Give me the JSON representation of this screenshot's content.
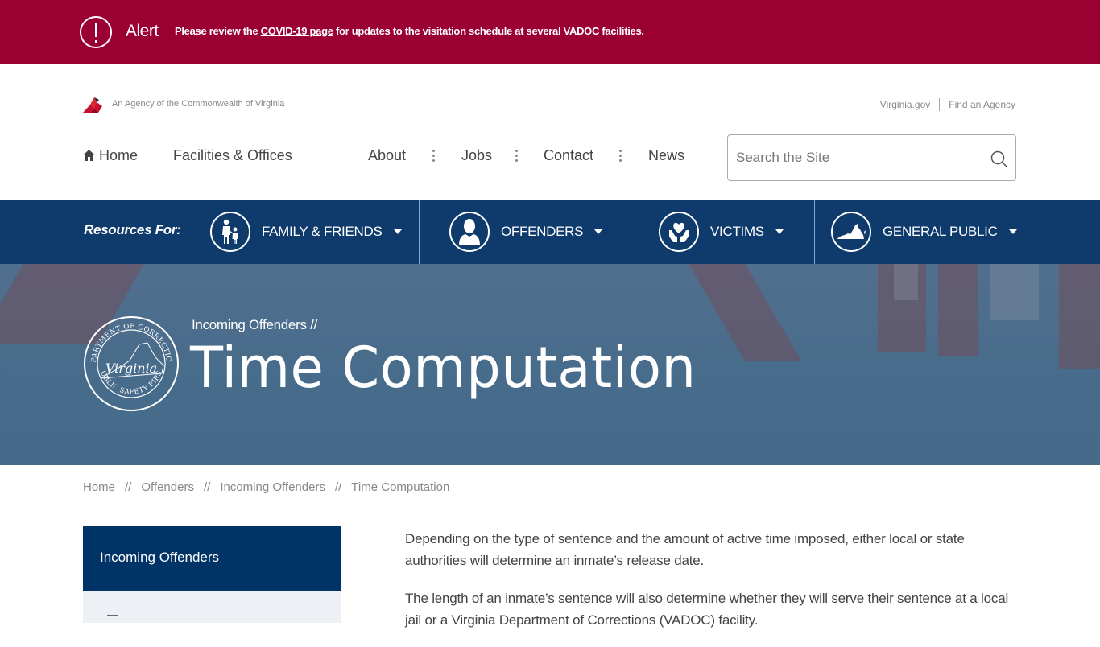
{
  "alert": {
    "icon": "exclamation-circle-icon",
    "label": "Alert",
    "text_before": "Please review the ",
    "link": "COVID-19 page",
    "text_after": " for updates to the visitation schedule at several VADOC facilities.",
    "background_color": "#9b0032"
  },
  "header": {
    "agency_logo_icon": "cardinal-icon",
    "agency_text": "An Agency of the Commonwealth of Virginia",
    "top_links": [
      "Virginia.gov",
      "Find an Agency"
    ]
  },
  "nav": {
    "home": "Home",
    "facilities": "Facilities & Offices",
    "about": "About",
    "jobs": "Jobs",
    "contact": "Contact",
    "news": "News"
  },
  "search": {
    "placeholder": "Search the Site",
    "value": ""
  },
  "resources": {
    "label": "Resources For:",
    "items": [
      {
        "label": "FAMILY & FRIENDS",
        "icon": "family-icon"
      },
      {
        "label": "OFFENDERS",
        "icon": "person-icon"
      },
      {
        "label": "VICTIMS",
        "icon": "heart-hands-icon"
      },
      {
        "label": "GENERAL PUBLIC",
        "icon": "virginia-state-icon"
      }
    ],
    "background_color": "#0e3a6c"
  },
  "hero": {
    "seal_top": "DEPARTMENT OF CORRECTIONS",
    "seal_middle": "Virginia",
    "seal_bottom": "PUBLIC SAFETY FIRST",
    "parent": "Incoming Offenders  //",
    "title": "Time Computation"
  },
  "breadcrumb": {
    "items": [
      "Home",
      "Offenders",
      "Incoming Offenders",
      "Time Computation"
    ],
    "separator": "//"
  },
  "sidebar": {
    "heading": "Incoming Offenders"
  },
  "content": {
    "paragraphs": [
      "Depending on the type of sentence and the amount of active time imposed, either local or state authorities will determine an inmate’s release date.",
      "The length of an inmate’s sentence will also determine whether they will serve their sentence at a local jail or a Virginia Department of Corrections (VADOC) facility."
    ]
  }
}
